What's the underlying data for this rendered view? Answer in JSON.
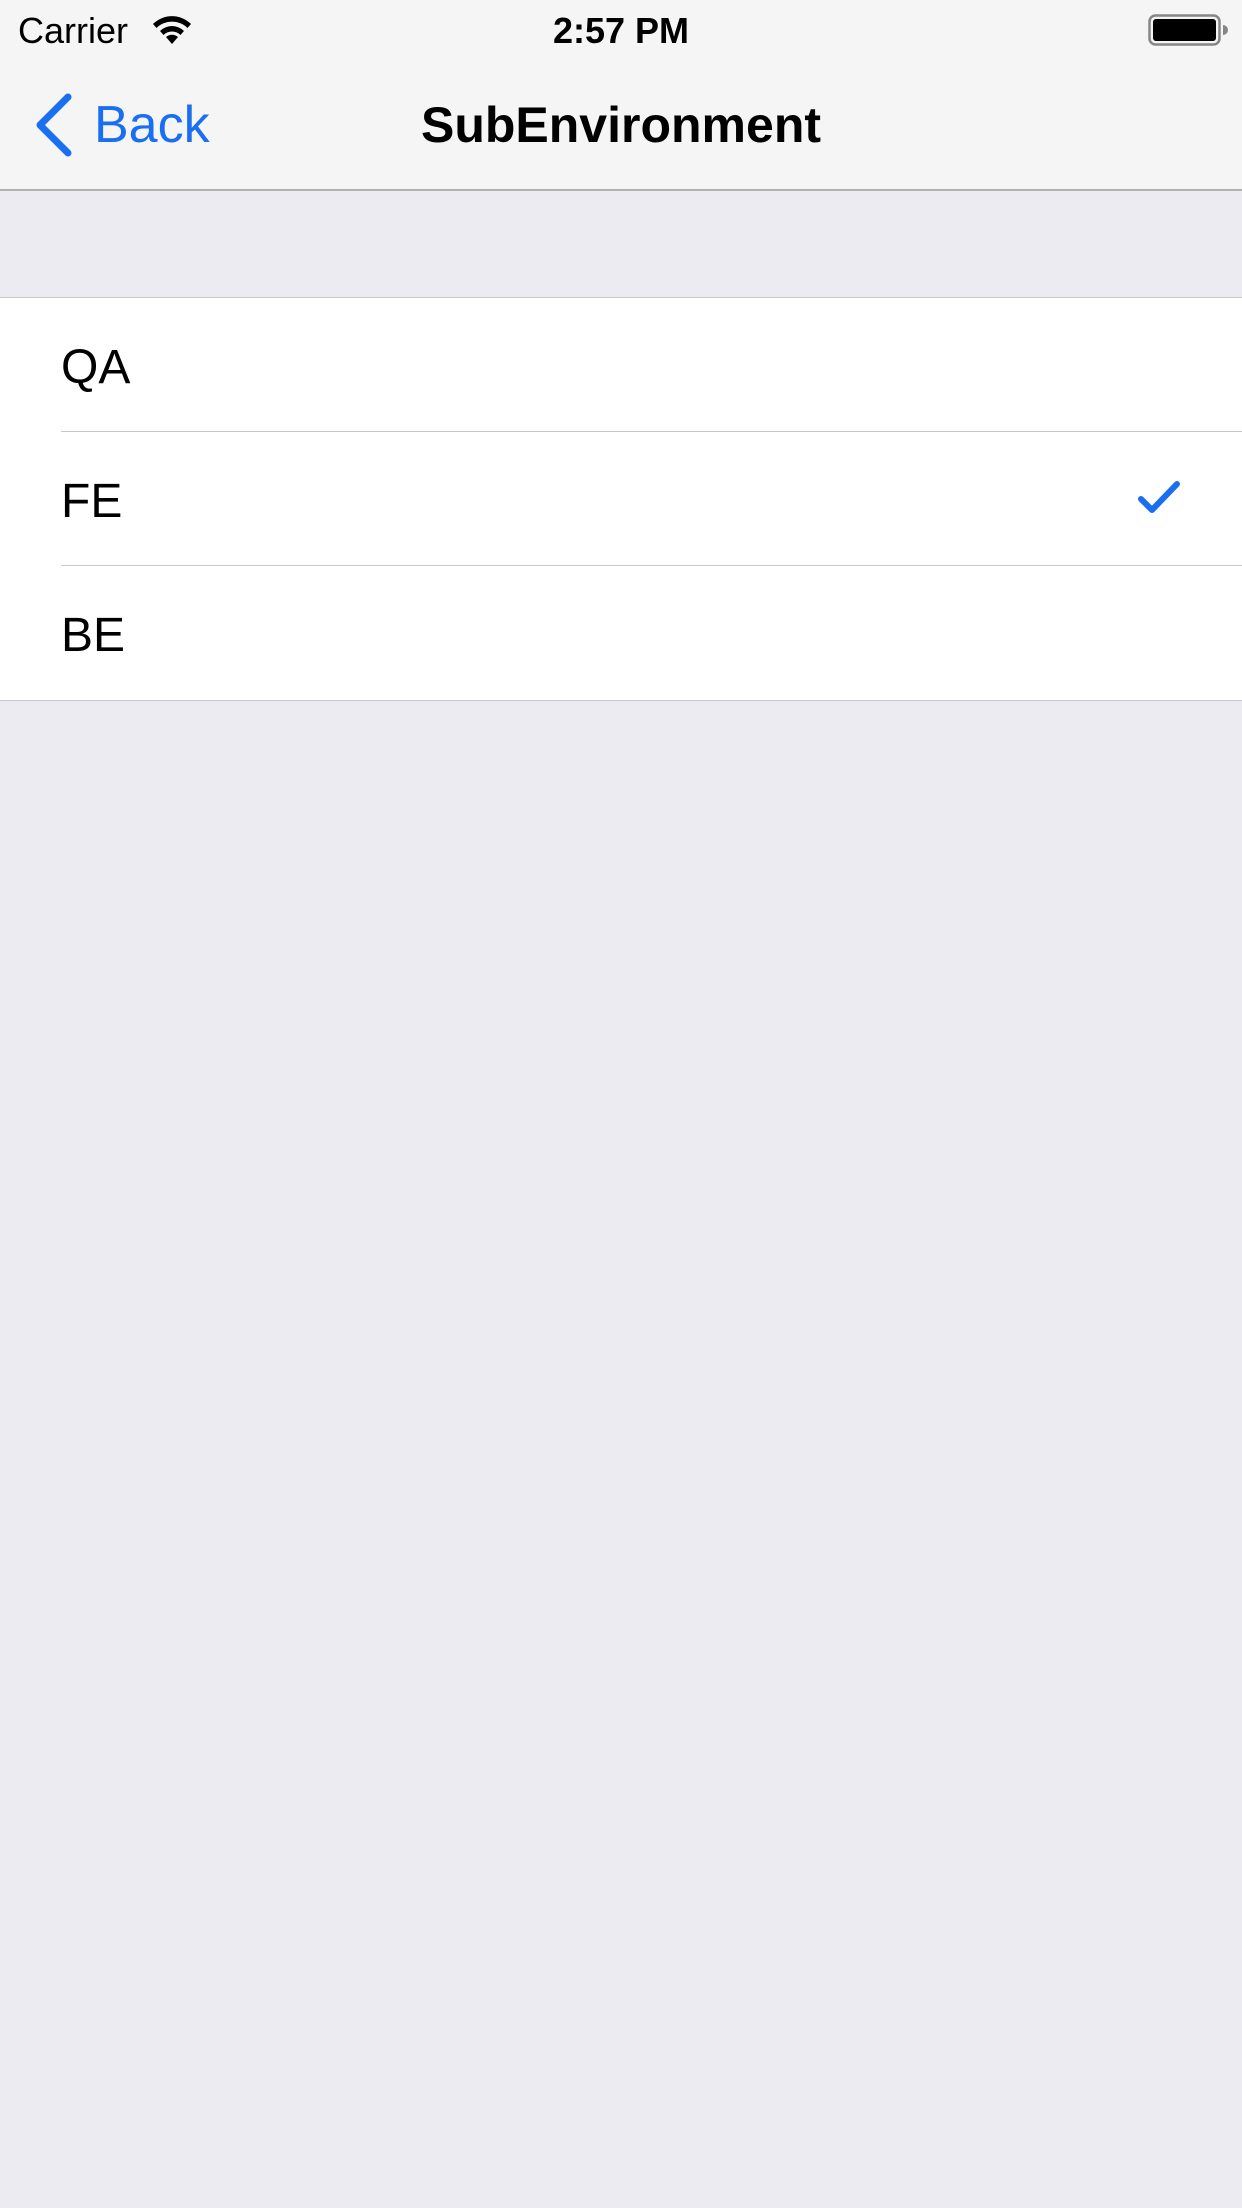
{
  "status_bar": {
    "carrier": "Carrier",
    "time": "2:57 PM",
    "wifi_icon": "wifi-icon",
    "battery_icon": "battery-icon"
  },
  "nav": {
    "back_label": "Back",
    "back_icon": "chevron-left-icon",
    "title": "SubEnvironment"
  },
  "list": {
    "items": [
      {
        "label": "QA",
        "selected": false
      },
      {
        "label": "FE",
        "selected": true
      },
      {
        "label": "BE",
        "selected": false
      }
    ],
    "check_icon": "checkmark-icon"
  },
  "colors": {
    "accent": "#1a6ff0",
    "background": "#ebebf1",
    "bar": "#f5f5f6",
    "separator": "#c8c7cc"
  }
}
